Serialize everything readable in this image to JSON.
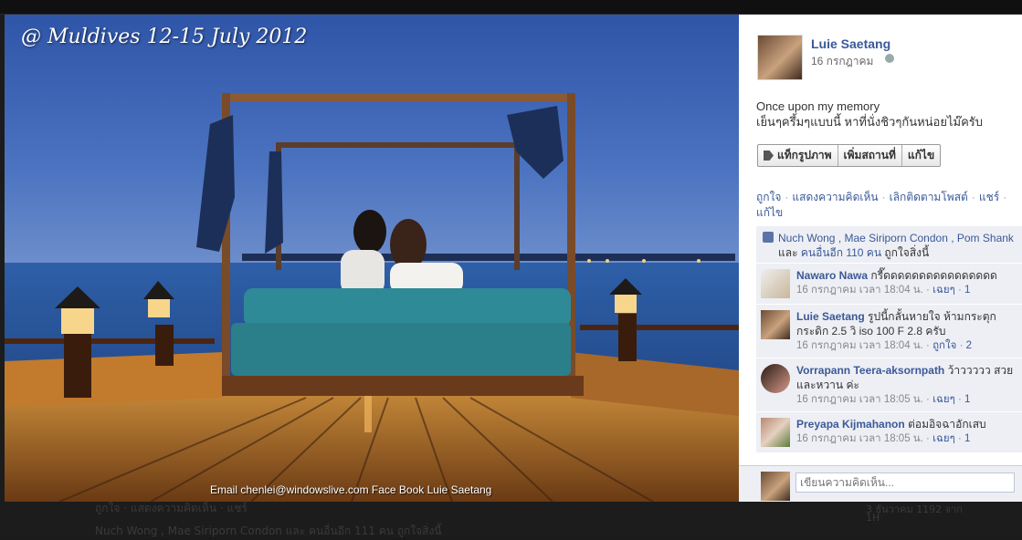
{
  "photo": {
    "caption": "@ Muldives  12-15 July 2012",
    "watermark": "Email  chenlei@windowslive.com Face Book Luie Saetang"
  },
  "post": {
    "author_name": "Luie Saetang",
    "date": "16 กรกฎาคม",
    "description_line1": "Once upon my memory",
    "description_line2": "เย็นๆครึ้มๆแบบนี้ หาที่นั่งชิวๆกันหน่อยไม๊ครับ",
    "buttons": {
      "tag": "แท็กรูปภาพ",
      "location": "เพิ่มสถานที่",
      "edit": "แก้ไข"
    },
    "actions": {
      "like": "ถูกใจ",
      "comment": "แสดงความคิดเห็น",
      "unfollow": "เลิกติดตามโพสต์",
      "share": "แชร์",
      "edit": "แก้ไข"
    },
    "likes": {
      "names": "Nuch Wong , Mae Siriporn Condon , Pom Shank",
      "and": "และ",
      "others": "คนอื่นอีก 110 คน",
      "suffix": "ถูกใจสิ่งนี้"
    }
  },
  "comments": [
    {
      "name": "Nawaro Nawa",
      "text": "กรี๊ดดดดดดดดดดดดดดดด",
      "time": "16 กรกฎาคม เวลา 18:04 น.",
      "action": "เฉยๆ",
      "likes": "1"
    },
    {
      "name": "Luie Saetang",
      "text": "รูปนี้กลั้นหายใจ ห้ามกระตุกกระดิก 2.5 วิ iso 100 F 2.8 ครับ",
      "time": "16 กรกฎาคม เวลา 18:04 น.",
      "action": "ถูกใจ",
      "likes": "2"
    },
    {
      "name": "Vorrapann Teera-aksornpath",
      "text": "ว้าววววว สวยและหวาน ค่ะ",
      "time": "16 กรกฎาคม เวลา 18:05 น.",
      "action": "เฉยๆ",
      "likes": "1"
    },
    {
      "name": "Preyapa Kijmahanon",
      "text": "ต่อมอิจฉาอักเสบ",
      "time": "16 กรกฎาคม เวลา 18:05 น.",
      "action": "เฉยๆ",
      "likes": "1"
    }
  ],
  "composer": {
    "placeholder": "เขียนความคิดเห็น..."
  },
  "background": {
    "likes_line": "Nuch Wong , Mae Siriporn Condon และ คนอื่นอีก 111 คน ถูกใจสิ่งนี้",
    "actions_line": "ถูกใจ · แสดงความคิดเห็น · แชร์",
    "right_text": "3 ธันวาคม 1192 จาก",
    "right_text2": "1H"
  },
  "colors": {
    "link": "#3b5998",
    "panel_bg": "#edeff4"
  }
}
